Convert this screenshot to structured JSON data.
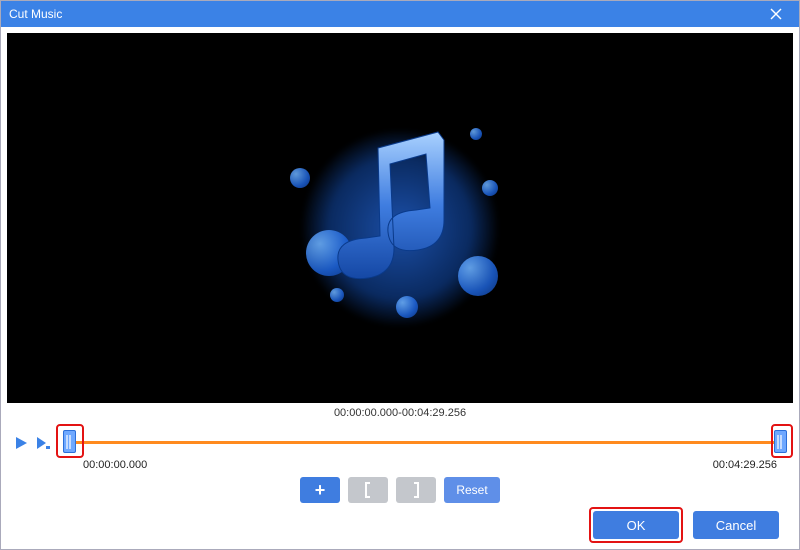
{
  "title": "Cut Music",
  "range_display": "00:00:00.000-00:04:29.256",
  "start_time": "00:00:00.000",
  "end_time": "00:04:29.256",
  "buttons": {
    "reset": "Reset",
    "ok": "OK",
    "cancel": "Cancel"
  },
  "icons": {
    "close": "×",
    "plus": "+"
  }
}
